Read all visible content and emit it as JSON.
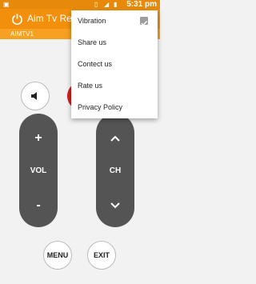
{
  "status_bar": {
    "time": "5:31 pm",
    "icons": [
      "notification-icon",
      "vibrate-icon",
      "signal-icon",
      "battery-icon"
    ]
  },
  "app_bar": {
    "title": "Aim Tv Remote",
    "icon": "power-icon"
  },
  "sub_bar": {
    "label": "AIMTV1"
  },
  "remote": {
    "mute_icon": "speaker-icon",
    "volume": {
      "up": "+",
      "label": "VOL",
      "down": "-"
    },
    "channel": {
      "up": "chevron-up-icon",
      "label": "CH",
      "down": "chevron-down-icon"
    },
    "menu_label": "MENU",
    "exit_label": "EXIT"
  },
  "overflow_menu": {
    "items": [
      {
        "label": "Vibration",
        "checked": true
      },
      {
        "label": "Share us"
      },
      {
        "label": "Contect us"
      },
      {
        "label": "Rate us"
      },
      {
        "label": "Privacy Policy"
      }
    ]
  },
  "colors": {
    "status_bar": "#e78a0c",
    "app_bar": "#f2900e",
    "sub_bar": "#f7a021",
    "pill": "#545454",
    "red_button": "#d61e17"
  }
}
